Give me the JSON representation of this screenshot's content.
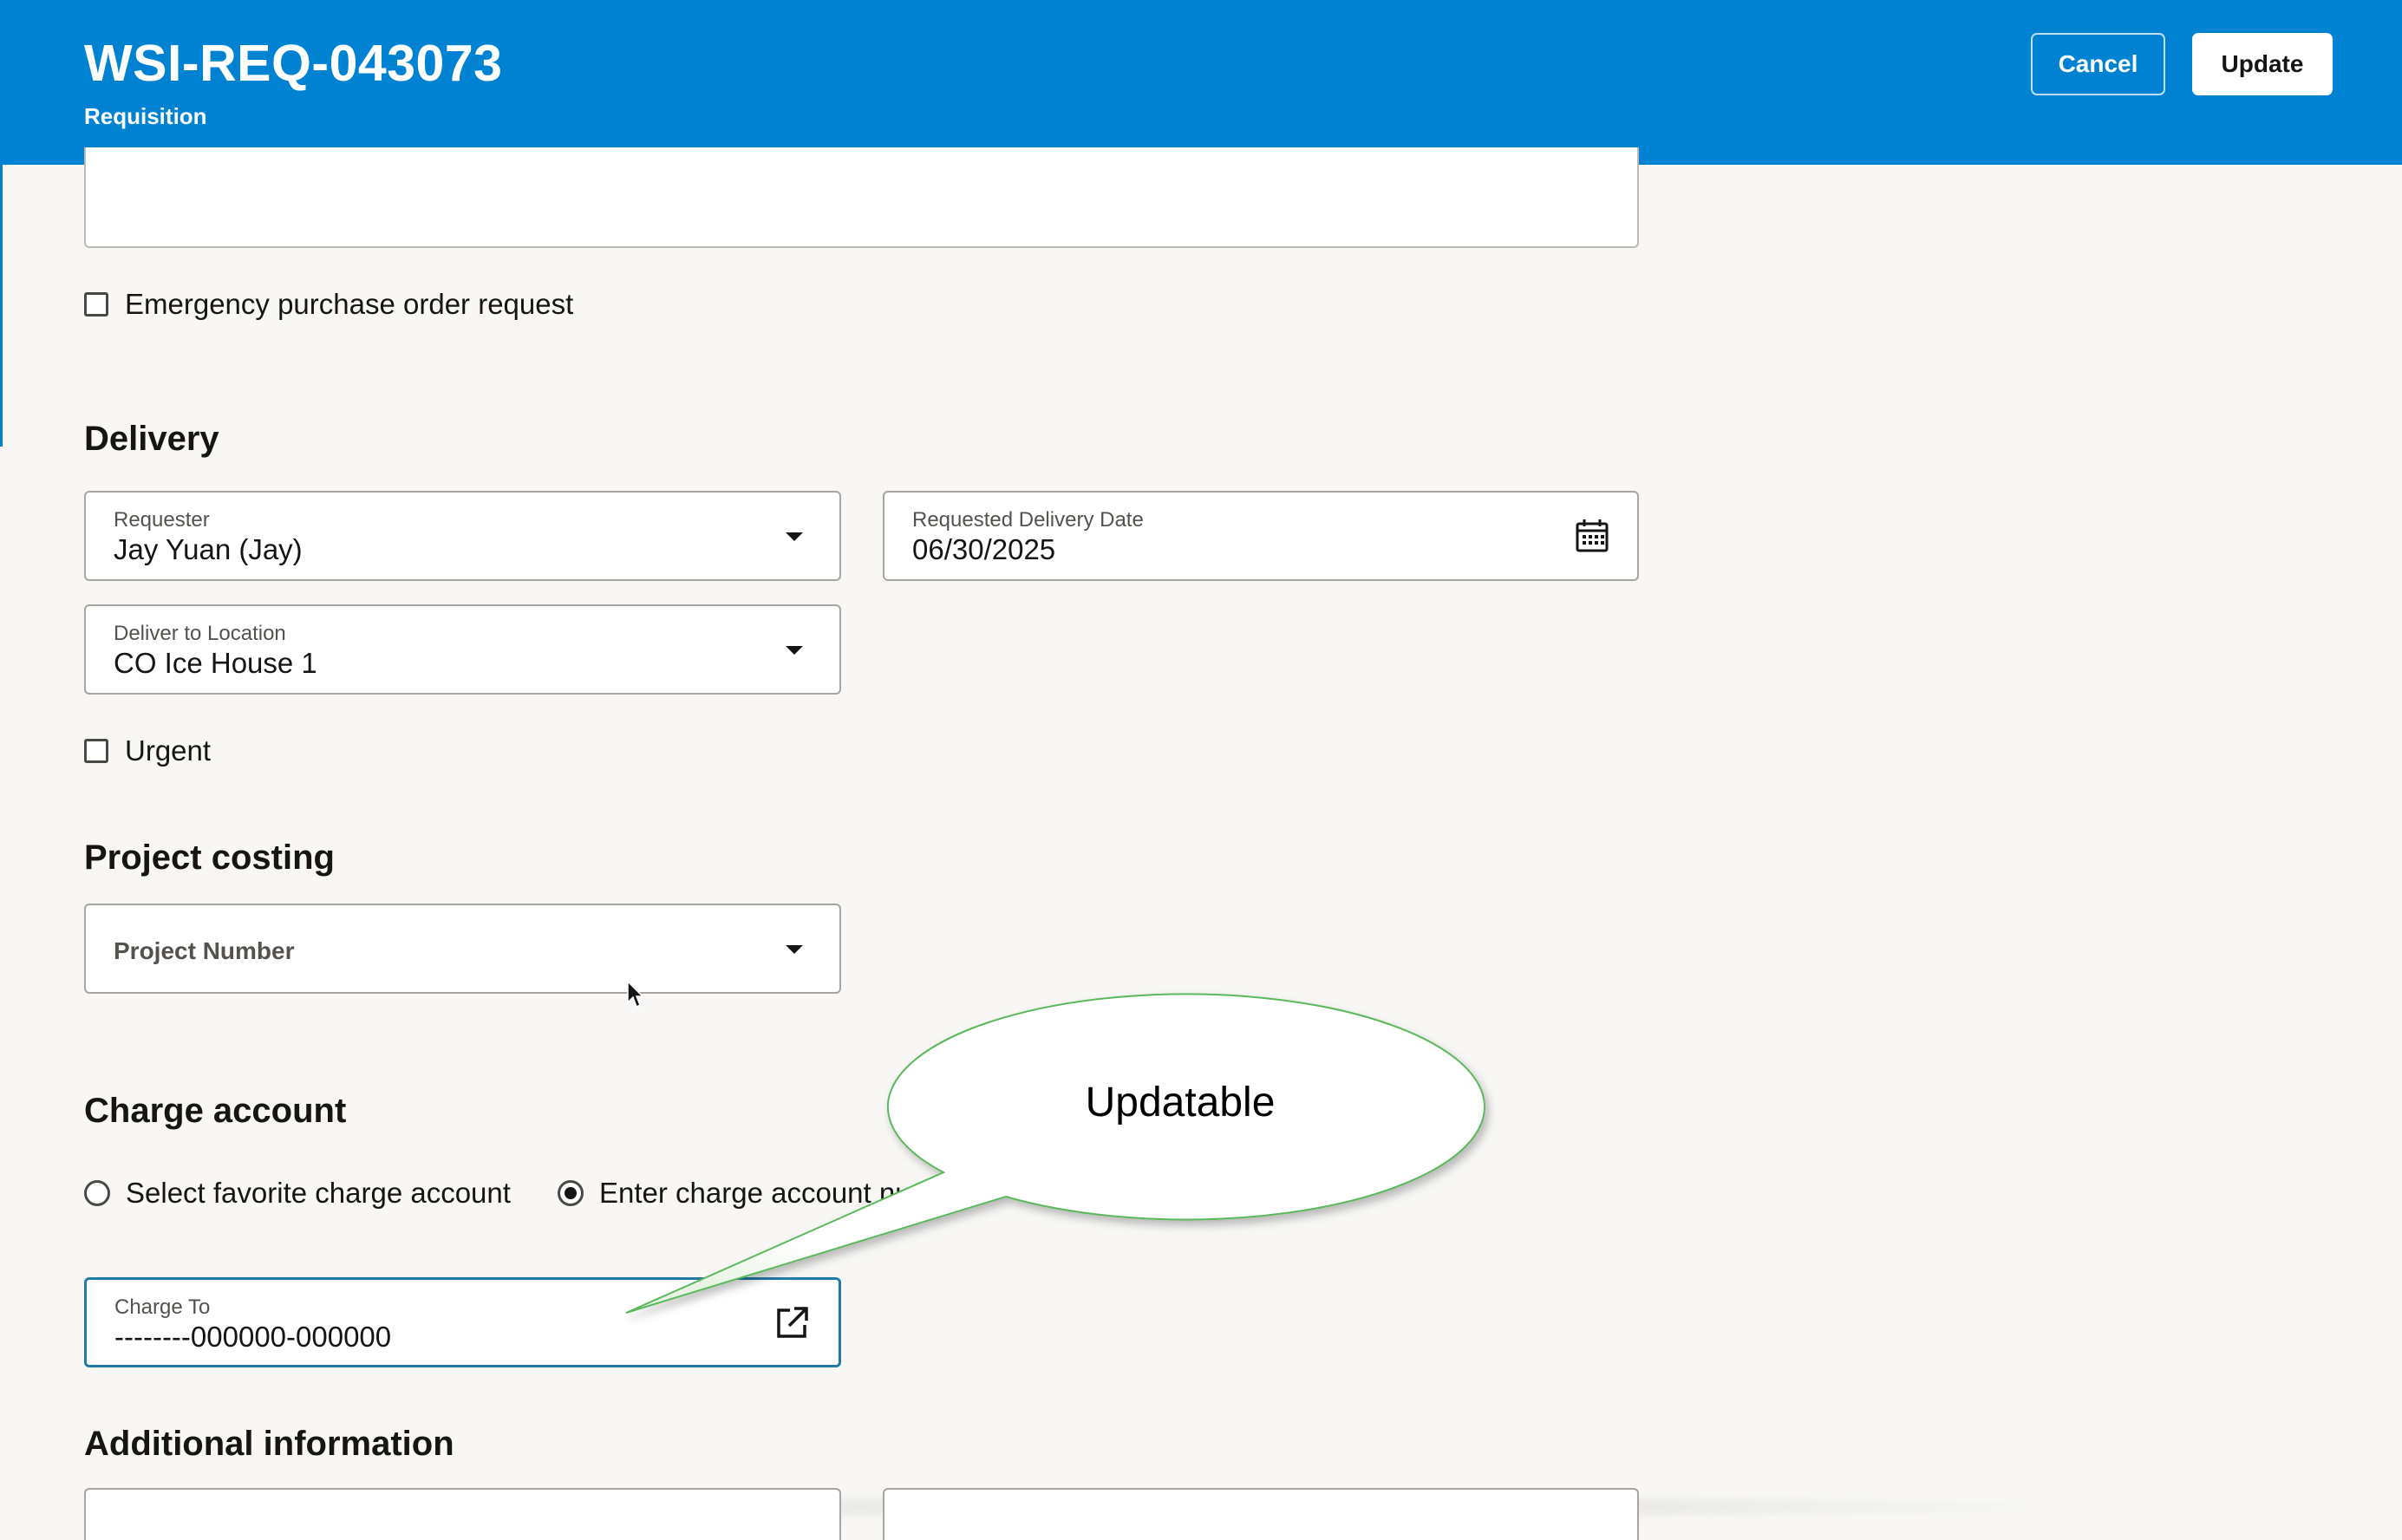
{
  "header": {
    "title": "WSI-REQ-043073",
    "subtitle": "Requisition",
    "cancel_label": "Cancel",
    "update_label": "Update",
    "background_color": "#0082d3"
  },
  "checkboxes": {
    "emergency_label": "Emergency purchase order request",
    "emergency_checked": false,
    "urgent_label": "Urgent",
    "urgent_checked": false
  },
  "delivery": {
    "section_title": "Delivery",
    "requester": {
      "label": "Requester",
      "value": "Jay Yuan (Jay)"
    },
    "requested_delivery_date": {
      "label": "Requested Delivery Date",
      "value": "06/30/2025"
    },
    "deliver_to_location": {
      "label": "Deliver to Location",
      "value": "CO Ice House 1"
    }
  },
  "project_costing": {
    "section_title": "Project costing",
    "project_number_placeholder": "Project Number"
  },
  "charge_account": {
    "section_title": "Charge account",
    "options": [
      {
        "label": "Select favorite charge account",
        "selected": false
      },
      {
        "label": "Enter charge account nu",
        "selected": true
      }
    ],
    "charge_to": {
      "label": "Charge To",
      "value": "--------000000-000000"
    }
  },
  "additional_information": {
    "section_title": "Additional information"
  },
  "callout": {
    "text": "Updatable",
    "border_color": "#5cb85c"
  },
  "icons": {
    "calendar": "calendar-icon",
    "external_link": "external-link-icon",
    "dropdown": "chevron-down-icon",
    "cursor": "mouse-pointer-icon"
  }
}
